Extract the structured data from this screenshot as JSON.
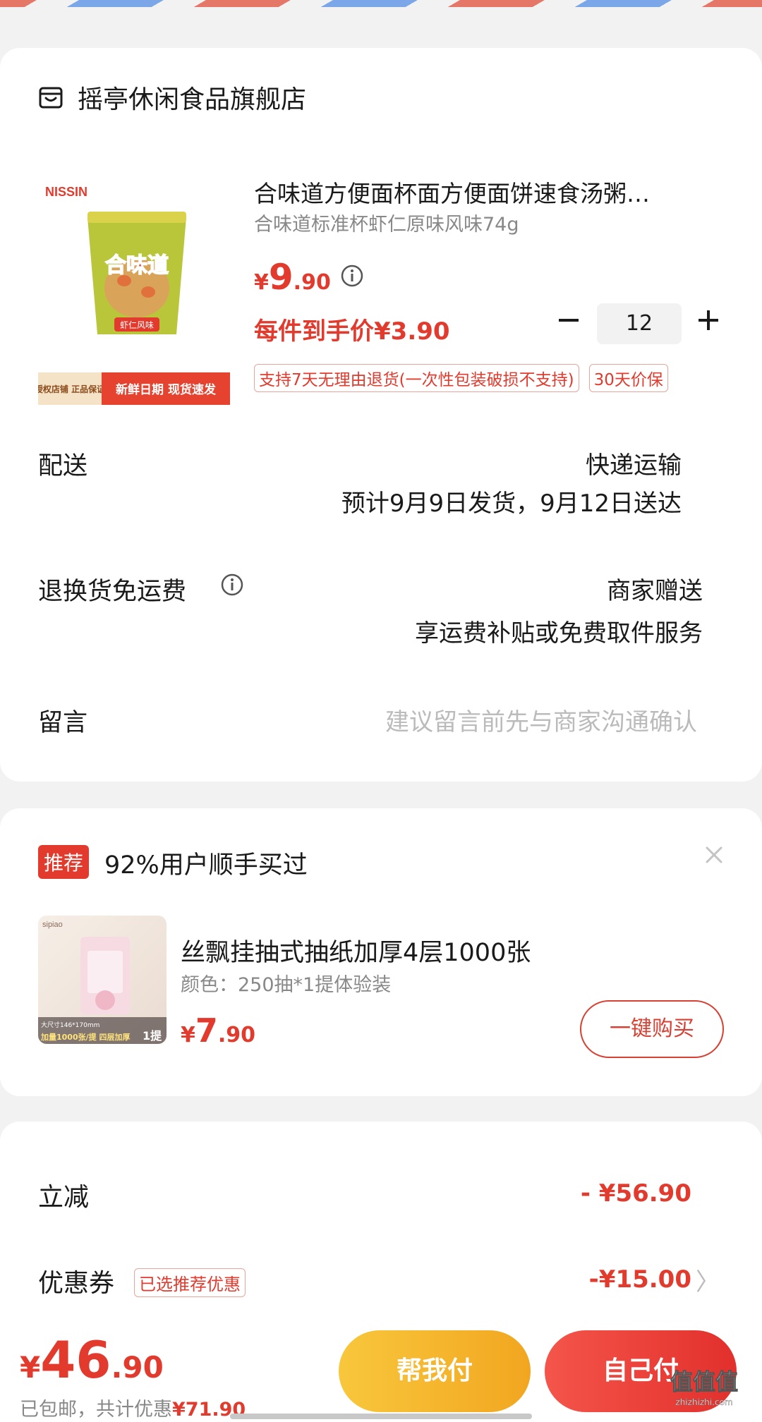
{
  "store": {
    "name": "摇亭休闲食品旗舰店"
  },
  "product": {
    "title": "合味道方便面杯面方便面饼速食汤粥…",
    "spec": "合味道标准杯虾仁原味风味74g",
    "price_symbol": "¥",
    "price_int": "9",
    "price_dec": ".90",
    "unit_price_text": "每件到手价¥3.90",
    "quantity": "12",
    "tags": [
      "支持7天无理由退货(一次性包装破损不支持)",
      "30天价保"
    ],
    "image": {
      "brand": "NISSIN",
      "cup_text": "合味道",
      "flavor_text": "虾仁风味",
      "badge_left": "授权店铺 正品保证",
      "badge_right": "新鲜日期 现货速发"
    }
  },
  "delivery": {
    "label": "配送",
    "method": "快递运输",
    "estimate": "预计9月9日发货，9月12日送达"
  },
  "return_freight": {
    "label": "退换货免运费",
    "value": "商家赠送",
    "desc": "享运费补贴或免费取件服务"
  },
  "message": {
    "label": "留言",
    "placeholder": "建议留言前先与商家沟通确认"
  },
  "recommend": {
    "badge": "推荐",
    "title": "92%用户顺手买过",
    "item_name": "丝飘挂抽式抽纸加厚4层1000张",
    "item_spec": "颜色：250抽*1提体验装",
    "price_symbol": "¥",
    "price_int": "7",
    "price_dec": ".90",
    "buy_label": "一键购买",
    "image": {
      "brand": "sipiao",
      "size_text": "大尺寸146*170mm",
      "count_text": "加量1000张/提 四层加厚",
      "pack_text": "1提"
    }
  },
  "summary": {
    "discount_label": "立减",
    "discount_value": "- ¥56.90",
    "coupon_label": "优惠券",
    "coupon_tag": "已选推荐优惠",
    "coupon_value": "-¥15.00",
    "coupon_chevron": "〉"
  },
  "bottom": {
    "total_symbol": "¥",
    "total_int": "46",
    "total_dec": ".90",
    "shipping_text": "已包邮，共计优惠",
    "total_discount": "¥71.90",
    "help_pay_label": "帮我付",
    "self_pay_label": "自己付"
  },
  "watermark": {
    "text": "值值值",
    "subtext": "zhizhizhi.com"
  },
  "colors": {
    "accent": "#e23b2e",
    "help_pay": "#f4b62c",
    "self_pay": "#e8383a"
  }
}
